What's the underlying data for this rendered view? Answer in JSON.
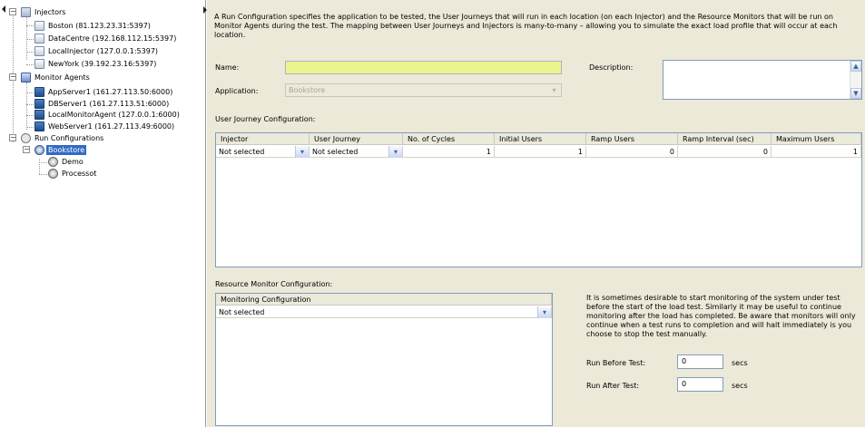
{
  "tree": {
    "injectors": {
      "label": "Injectors",
      "items": [
        "Boston (81.123.23.31:5397)",
        "DataCentre (192.168.112.15:5397)",
        "LocalInjector (127.0.0.1:5397)",
        "NewYork (39.192.23.16:5397)"
      ]
    },
    "monitor_agents": {
      "label": "Monitor Agents",
      "items": [
        "AppServer1 (161.27.113.50:6000)",
        "DBServer1 (161.27.113.51:6000)",
        "LocalMonitorAgent (127.0.0.1:6000)",
        "WebServer1 (161.27.113.49:6000)"
      ]
    },
    "run_configurations": {
      "label": "Run Configurations",
      "selected": "Bookstore",
      "children": [
        "Demo",
        "Processot"
      ]
    },
    "icons": {
      "expander": "minus-box-icon",
      "injector": "injector-icon",
      "agent": "monitor-agent-icon",
      "journey": "user-journey-icon"
    }
  },
  "form": {
    "intro": "A Run Configuration specifies the application to be tested, the User Journeys that will run in each location (on each Injector) and the Resource Monitors that will be run on Monitor Agents during the test.  The mapping between User Journeys and Injectors is many-to-many – allowing you to simulate the exact load profile that will occur at each location.",
    "name_label": "Name:",
    "name_value": "",
    "description_label": "Description:",
    "description_value": "",
    "application_label": "Application:",
    "application_value": "Bookstore",
    "uj_section_label": "User Journey Configuration:",
    "uj_headers": [
      "Injector",
      "User Journey",
      "No. of Cycles",
      "Initial Users",
      "Ramp Users",
      "Ramp Interval (sec)",
      "Maximum Users"
    ],
    "uj_row": {
      "injector": "Not selected",
      "journey": "Not selected",
      "cycles": "1",
      "initial_users": "1",
      "ramp_users": "0",
      "ramp_interval": "0",
      "max_users": "1"
    },
    "rm_section_label": "Resource Monitor Configuration:",
    "rm_header": "Monitoring Configuration",
    "rm_value": "Not selected",
    "rm_note": "It is sometimes desirable to start monitoring of the system under test before the start of the load test. Similarly it may be useful to continue monitoring after the load has completed. Be aware that monitors will only continue when a test runs to completion and will halt immediately is you choose to stop the test manually.",
    "run_before_label": "Run Before Test:",
    "run_before_value": "0",
    "run_after_label": "Run After Test:",
    "run_after_value": "0",
    "secs_label": "secs"
  },
  "colors": {
    "panel_bg": "#ece9d8",
    "name_field_bg": "#ecf48f",
    "selection": "#316ac5",
    "field_border": "#7f9db9"
  }
}
